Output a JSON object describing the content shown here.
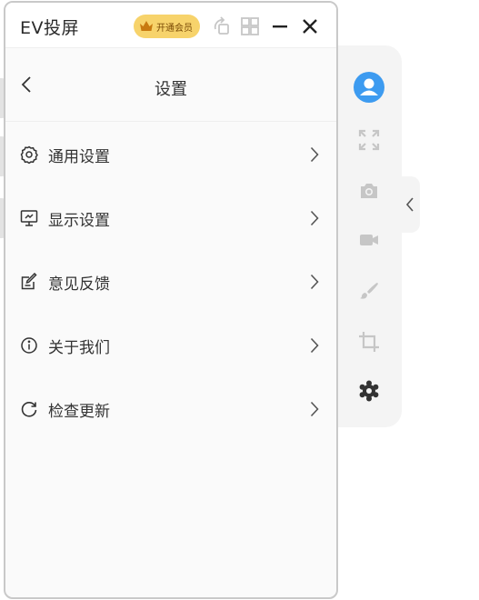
{
  "window": {
    "title": "EV投屏",
    "vip_label": "开通会员"
  },
  "settings": {
    "title": "设置",
    "items": [
      {
        "label": "通用设置",
        "icon": "gear-outline-icon"
      },
      {
        "label": "显示设置",
        "icon": "monitor-icon"
      },
      {
        "label": "意见反馈",
        "icon": "feedback-edit-icon"
      },
      {
        "label": "关于我们",
        "icon": "info-circle-icon"
      },
      {
        "label": "检查更新",
        "icon": "refresh-icon"
      }
    ]
  },
  "toolbar": {
    "items": [
      "avatar-icon",
      "fullscreen-icon",
      "camera-icon",
      "video-icon",
      "brush-icon",
      "crop-icon",
      "settings-icon"
    ]
  },
  "colors": {
    "accent": "#3d9bf0",
    "vip": "#f7d36b",
    "icon_gray": "#c6c6c6",
    "icon_dark": "#333333"
  }
}
